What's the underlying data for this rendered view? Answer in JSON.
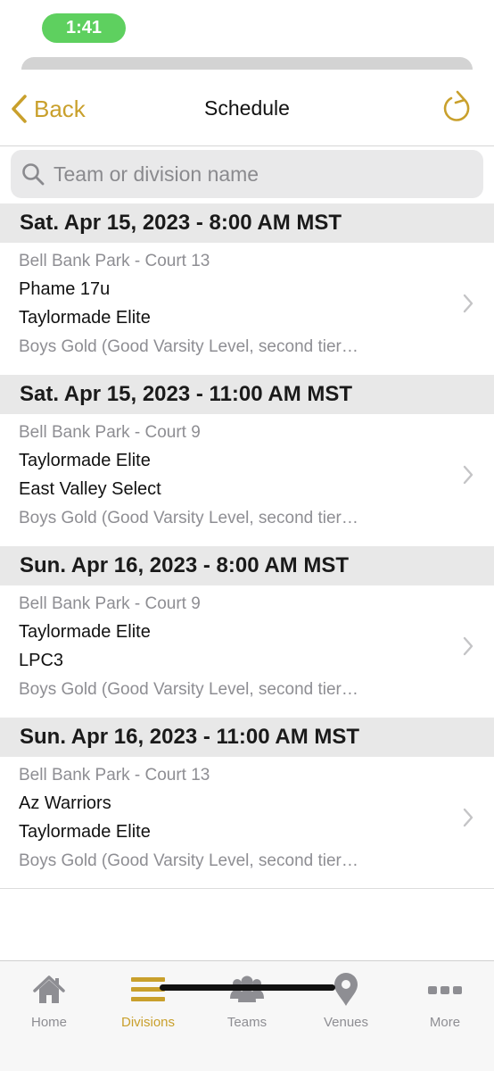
{
  "status_bar": {
    "time": "1:41"
  },
  "nav": {
    "back_label": "Back",
    "title": "Schedule"
  },
  "search": {
    "placeholder": "Team or division name",
    "value": ""
  },
  "colors": {
    "accent": "#c9a02c",
    "status_pill": "#5ed05f",
    "header_bg": "#e8e8e8"
  },
  "schedule": [
    {
      "date": "Sat. Apr 15, 2023 - 8:00 AM MST",
      "venue": "Bell Bank Park - Court 13",
      "team1": "Phame 17u",
      "team2": "Taylormade Elite",
      "division": "Boys Gold (Good Varsity Level, second tier…"
    },
    {
      "date": "Sat. Apr 15, 2023 - 11:00 AM MST",
      "venue": "Bell Bank Park - Court 9",
      "team1": "Taylormade Elite",
      "team2": "East Valley Select",
      "division": "Boys Gold (Good Varsity Level, second tier…"
    },
    {
      "date": "Sun. Apr 16, 2023 - 8:00 AM MST",
      "venue": "Bell Bank Park - Court 9",
      "team1": "Taylormade Elite",
      "team2": "LPC3",
      "division": "Boys Gold (Good Varsity Level, second tier…"
    },
    {
      "date": "Sun. Apr 16, 2023 - 11:00 AM MST",
      "venue": "Bell Bank Park - Court 13",
      "team1": "Az Warriors",
      "team2": "Taylormade Elite",
      "division": "Boys Gold (Good Varsity Level, second tier…"
    }
  ],
  "tabs": [
    {
      "label": "Home",
      "icon": "home-icon",
      "active": false
    },
    {
      "label": "Divisions",
      "icon": "menu-lines-icon",
      "active": true
    },
    {
      "label": "Teams",
      "icon": "people-icon",
      "active": false
    },
    {
      "label": "Venues",
      "icon": "map-pin-icon",
      "active": false
    },
    {
      "label": "More",
      "icon": "more-dots-icon",
      "active": false
    }
  ]
}
